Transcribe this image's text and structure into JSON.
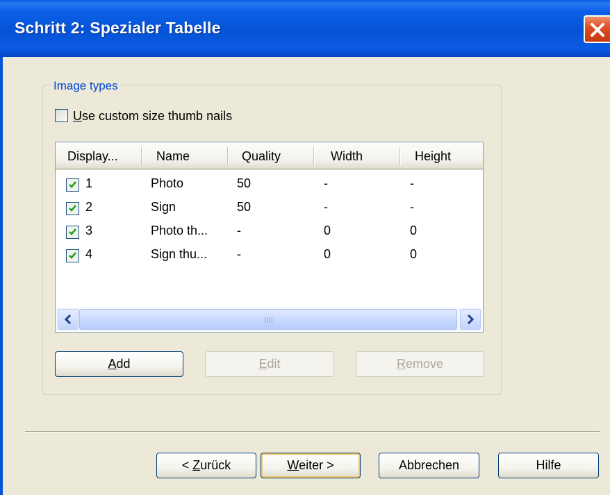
{
  "window": {
    "title": "Schritt 2: Spezialer Tabelle"
  },
  "group": {
    "label": "Image types",
    "custom_size": {
      "checked": false,
      "prefix": "U",
      "rest": "se custom size thumb nails"
    }
  },
  "list": {
    "columns": [
      "Display...",
      "Name",
      "Quality",
      "Width",
      "Height"
    ],
    "rows": [
      {
        "checked": true,
        "display": "1",
        "name": "Photo",
        "quality": "50",
        "width": "-",
        "height": "-"
      },
      {
        "checked": true,
        "display": "2",
        "name": "Sign",
        "quality": "50",
        "width": "-",
        "height": "-"
      },
      {
        "checked": true,
        "display": "3",
        "name": "Photo th...",
        "quality": "-",
        "width": "0",
        "height": "0"
      },
      {
        "checked": true,
        "display": "4",
        "name": "Sign thu...",
        "quality": "-",
        "width": "0",
        "height": "0"
      }
    ]
  },
  "actions": {
    "add": {
      "mn": "A",
      "rest": "dd"
    },
    "edit": {
      "mn": "E",
      "rest": "dit"
    },
    "remove": {
      "mn": "R",
      "rest": "emove"
    }
  },
  "footer": {
    "back": {
      "pre": "< ",
      "mn": "Z",
      "rest": "urück"
    },
    "next": {
      "mn": "W",
      "rest": "eiter >"
    },
    "cancel": "Abbrechen",
    "help": "Hilfe"
  },
  "icons": {
    "close": "close-icon",
    "check": "check-icon",
    "scroll_left": "chevron-left-icon",
    "scroll_right": "chevron-right-icon",
    "grip": "grip-icon"
  },
  "colors": {
    "titlebar": "#0553d6",
    "dialog_bg": "#ece9d8",
    "group_label": "#0046d5",
    "check_green": "#21a121",
    "default_button_ring": "#f1c56d"
  }
}
